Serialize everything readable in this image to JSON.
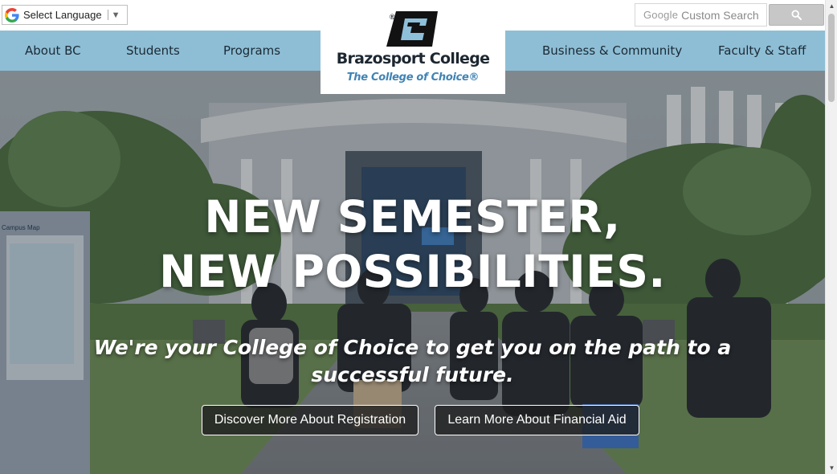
{
  "language": {
    "label": "Select Language",
    "arrow": "▼"
  },
  "search": {
    "google_word": "Google",
    "placeholder": "Custom Search"
  },
  "nav": {
    "items": [
      "About BC",
      "Students",
      "Programs",
      "Business & Community",
      "Faculty & Staff"
    ]
  },
  "logo": {
    "name": "Brazosport College",
    "tagline": "The College of Choice®"
  },
  "hero": {
    "headline_line1": "NEW SEMESTER,",
    "headline_line2": "NEW POSSIBILITIES.",
    "subtext": "We're your College of Choice to get you on the path to a successful future.",
    "buttons": [
      "Discover More About Registration",
      "Learn More About Financial Aid"
    ],
    "sign_text": "Campus Map"
  },
  "colors": {
    "nav": "#8ebed5",
    "brand_blue": "#3f84b6",
    "brand_dark": "#1d2730"
  },
  "icons": [
    "google-g-icon",
    "search-icon",
    "bc-logo-icon",
    "scroll-up-icon",
    "scroll-down-icon"
  ]
}
